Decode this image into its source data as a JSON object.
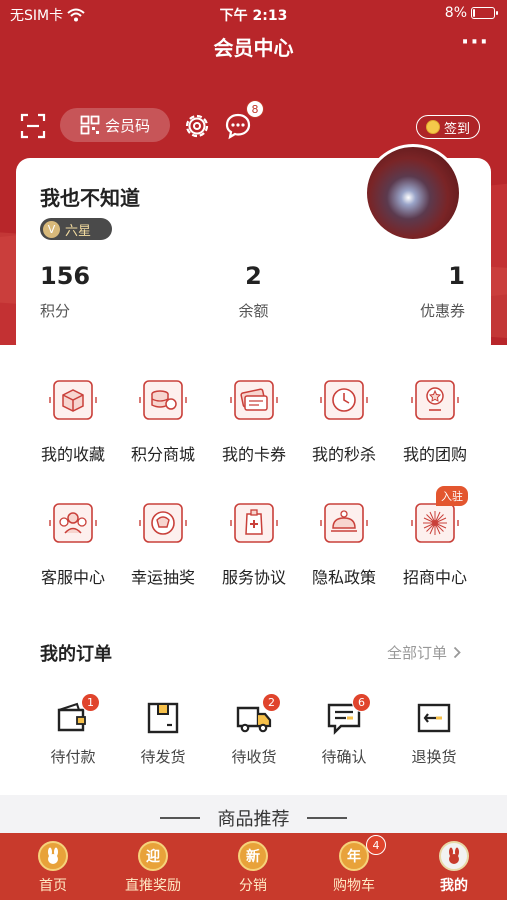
{
  "status_bar": {
    "carrier": "无SIM卡",
    "time": "下午 2:13",
    "battery": "8%",
    "battery_level": 0.08
  },
  "nav": {
    "title": "会员中心",
    "more": "···"
  },
  "toolbar": {
    "member_code_label": "会员码",
    "message_badge": "8",
    "signin_label": "签到",
    "icons": [
      "scan-icon",
      "qr-code-icon",
      "settings-icon",
      "message-icon",
      "coin-icon"
    ]
  },
  "profile": {
    "username": "我也不知道",
    "level_letter": "V",
    "level": "六星",
    "stats": [
      {
        "value": "156",
        "label": "积分"
      },
      {
        "value": "2",
        "label": "余额"
      },
      {
        "value": "1",
        "label": "优惠券"
      }
    ]
  },
  "grid": {
    "row1": [
      {
        "label": "我的收藏",
        "icon": "favorites-box-icon"
      },
      {
        "label": "积分商城",
        "icon": "points-mall-icon"
      },
      {
        "label": "我的卡券",
        "icon": "coupon-icon"
      },
      {
        "label": "我的秒杀",
        "icon": "flash-sale-clock-icon"
      },
      {
        "label": "我的团购",
        "icon": "group-buy-icon"
      }
    ],
    "row2": [
      {
        "label": "客服中心",
        "icon": "customer-service-icon"
      },
      {
        "label": "幸运抽奖",
        "icon": "lucky-draw-icon"
      },
      {
        "label": "服务协议",
        "icon": "service-agreement-icon"
      },
      {
        "label": "隐私政策",
        "icon": "privacy-policy-icon"
      },
      {
        "label": "招商中心",
        "icon": "merchant-center-icon",
        "tag": "入驻"
      }
    ]
  },
  "orders": {
    "title": "我的订单",
    "all_label": "全部订单",
    "items": [
      {
        "label": "待付款",
        "badge": "1",
        "icon": "wallet-icon"
      },
      {
        "label": "待发货",
        "badge": "",
        "icon": "package-icon"
      },
      {
        "label": "待收货",
        "badge": "2",
        "icon": "truck-icon"
      },
      {
        "label": "待确认",
        "badge": "6",
        "icon": "message-confirm-icon"
      },
      {
        "label": "退换货",
        "badge": "",
        "icon": "return-icon"
      }
    ]
  },
  "recommend": {
    "title": "商品推荐"
  },
  "tabbar": {
    "items": [
      {
        "label": "首页",
        "glyph": "",
        "icon": "home-rabbit-icon"
      },
      {
        "label": "直推奖励",
        "glyph": "迎",
        "icon": "reward-icon"
      },
      {
        "label": "分销",
        "glyph": "新",
        "icon": "distribution-icon"
      },
      {
        "label": "购物车",
        "glyph": "年",
        "icon": "cart-icon",
        "badge": "4"
      },
      {
        "label": "我的",
        "glyph": "",
        "icon": "profile-rabbit-icon"
      }
    ]
  },
  "colors": {
    "primary": "#b8262a",
    "tabbar": "#c83a2c",
    "badge": "#e0442c",
    "icon_line": "#c9403a"
  }
}
